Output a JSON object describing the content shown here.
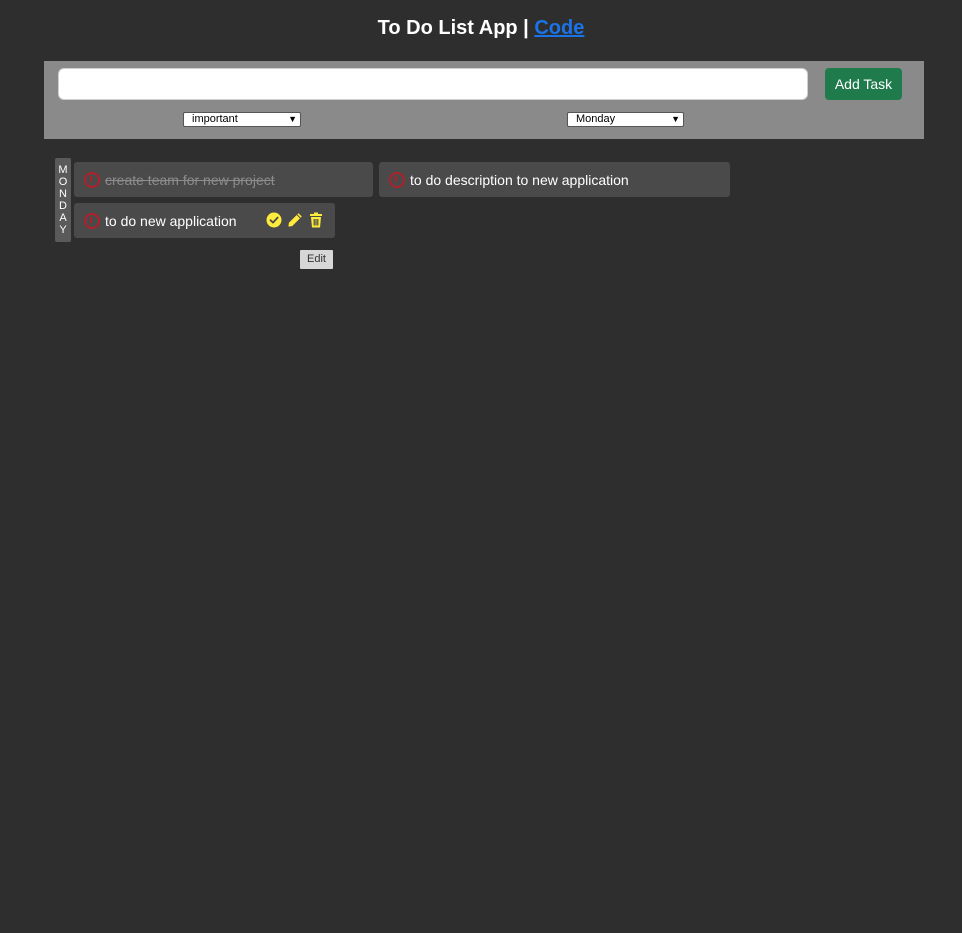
{
  "header": {
    "title": "To Do List App |",
    "code_link": "Code"
  },
  "form": {
    "input_value": "",
    "add_button": "Add Task",
    "priority_selected": "important",
    "day_selected": "Monday"
  },
  "day_group": {
    "label_letters": [
      "M",
      "O",
      "N",
      "D",
      "A",
      "Y"
    ]
  },
  "tasks": [
    {
      "text": "create team for new project",
      "done": true
    },
    {
      "text": "to do description to new application",
      "done": false
    },
    {
      "text": "to do new application",
      "done": false
    }
  ],
  "tooltip": "Edit",
  "colors": {
    "background": "#2e2e2e",
    "panel": "#8a8a8a",
    "accent_button": "#1f7a4c",
    "link": "#1a73e8",
    "action_icons": "#ffeb3b",
    "priority_icon": "#b0202a"
  },
  "icons": [
    "priority-alert-icon",
    "check-circle-icon",
    "pencil-icon",
    "trash-icon",
    "chevron-down-icon"
  ]
}
